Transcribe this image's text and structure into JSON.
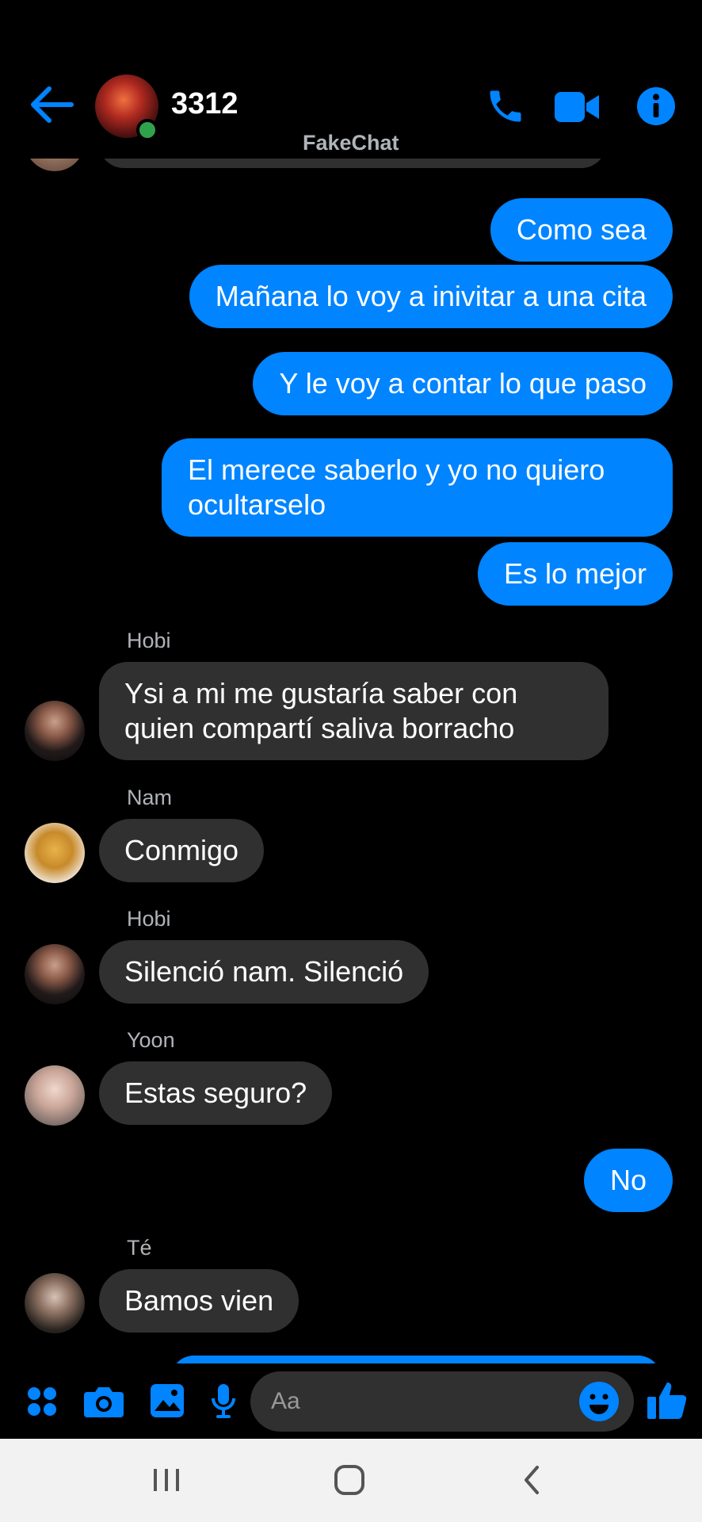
{
  "header": {
    "title": "3312",
    "watermark": "FakeChat"
  },
  "messages": [
    {
      "type": "out",
      "text": "Como sea"
    },
    {
      "type": "out",
      "text": "Mañana lo voy a inivitar a una cita"
    },
    {
      "type": "out",
      "text": "Y le voy a contar lo que paso"
    },
    {
      "type": "out",
      "text": "El merece saberlo y yo no quiero ocultarselo"
    },
    {
      "type": "out",
      "text": "Es lo mejor"
    },
    {
      "type": "in",
      "sender": "Hobi",
      "text": "Ysi a mi me gustaría saber con quien compartí saliva borracho"
    },
    {
      "type": "in",
      "sender": "Nam",
      "text": "Conmigo"
    },
    {
      "type": "in",
      "sender": "Hobi",
      "text": "Silenció nam. Silenció"
    },
    {
      "type": "in",
      "sender": "Yoon",
      "text": "Estas seguro?"
    },
    {
      "type": "out",
      "text": "No"
    },
    {
      "type": "in",
      "sender": "Té",
      "text": "Bamos vien"
    }
  ],
  "composer": {
    "placeholder": "Aa"
  },
  "colors": {
    "accent": "#0084ff",
    "incoming_bubble": "#303030",
    "background": "#000000",
    "online": "#31a24c"
  },
  "icons": {
    "back": "arrow-left-icon",
    "call": "phone-icon",
    "video": "video-camera-icon",
    "info": "info-icon",
    "apps": "grid-dots-icon",
    "camera": "camera-icon",
    "gallery": "image-icon",
    "mic": "microphone-icon",
    "emoji": "emoji-icon",
    "like": "thumbs-up-icon",
    "recents": "recents-icon",
    "home": "home-icon",
    "nav_back": "chevron-left-icon"
  }
}
